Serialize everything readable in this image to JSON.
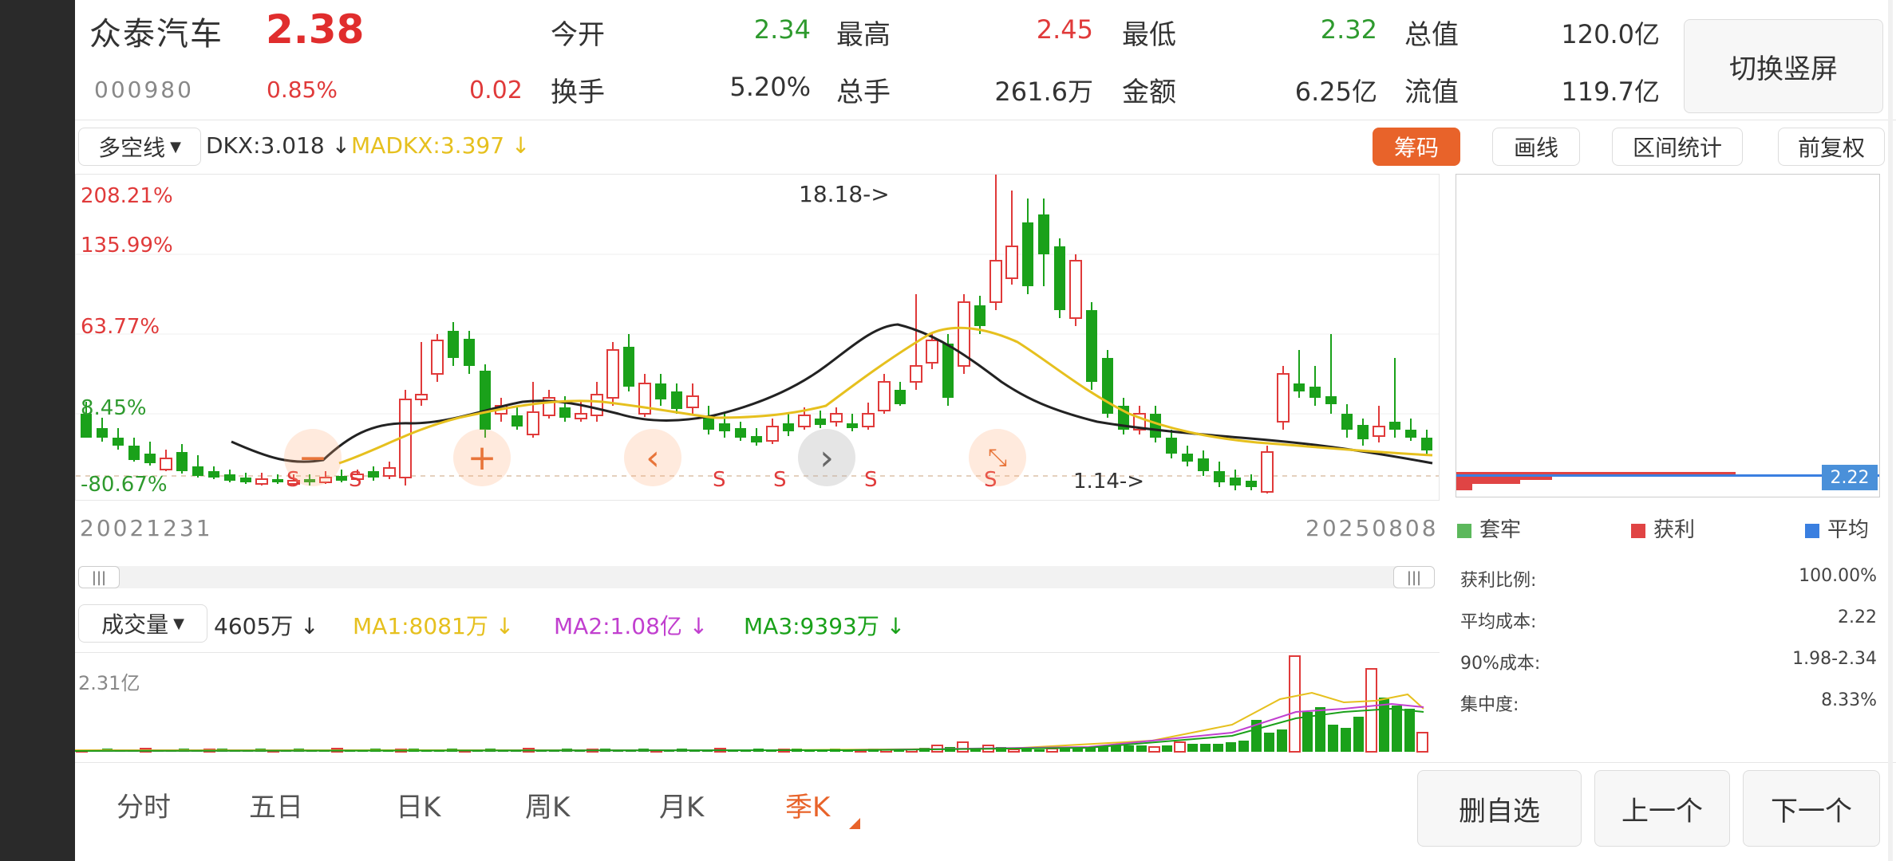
{
  "header": {
    "stock_name": "众泰汽车",
    "price": "2.38",
    "code": "000980",
    "change_pct": "0.85%",
    "change_abs": "0.02",
    "open_label": "今开",
    "open_value": "2.34",
    "high_label": "最高",
    "high_value": "2.45",
    "low_label": "最低",
    "low_value": "2.32",
    "total_mv_label": "总值",
    "total_mv_value": "120.0亿",
    "turnover_label": "换手",
    "turnover_value": "5.20%",
    "volume_label": "总手",
    "volume_value": "261.6万",
    "amount_label": "金额",
    "amount_value": "6.25亿",
    "float_mv_label": "流值",
    "float_mv_value": "119.7亿",
    "switch_button": "切换竖屏"
  },
  "indicator_bar": {
    "selector": "多空线",
    "dkx": "DKX:3.018 ↓",
    "madkx": "MADKX:3.397 ↓",
    "chips_button": "筹码",
    "draw_button": "画线",
    "range_stats_button": "区间统计",
    "adjust_button": "前复权"
  },
  "main_chart": {
    "y_labels": [
      "208.21%",
      "135.99%",
      "63.77%",
      "8.45%",
      "-80.67%"
    ],
    "start_date": "20021231",
    "end_date": "20250808",
    "max_annotation": "18.18->",
    "min_annotation": "1.14->",
    "signals": [
      "S",
      "S",
      "S",
      "S",
      "S",
      "S"
    ]
  },
  "volume_bar": {
    "selector": "成交量",
    "vol": "4605万 ↓",
    "ma1": "MA1:8081万 ↓",
    "ma2": "MA2:1.08亿 ↓",
    "ma3": "MA3:9393万 ↓",
    "y_label": "2.31亿"
  },
  "chip_panel": {
    "price_tag": "2.22",
    "legend_locked": "套牢",
    "legend_profit": "获利",
    "legend_avg": "平均",
    "profit_ratio_label": "获利比例:",
    "profit_ratio_value": "100.00%",
    "avg_cost_label": "平均成本:",
    "avg_cost_value": "2.22",
    "cost90_label": "90%成本:",
    "cost90_value": "1.98-2.34",
    "concentration_label": "集中度:",
    "concentration_value": "8.33%"
  },
  "bottom_tabs": [
    "分时",
    "五日",
    "日K",
    "周K",
    "月K",
    "季K"
  ],
  "bottom_buttons": {
    "delete": "删自选",
    "prev": "上一个",
    "next": "下一个"
  },
  "colors": {
    "up": "#e03a3a",
    "down": "#1aa11a",
    "accent": "#e8632a",
    "dkx": "#222222",
    "madkx": "#e6c01e",
    "ma2": "#c13fcf"
  }
}
